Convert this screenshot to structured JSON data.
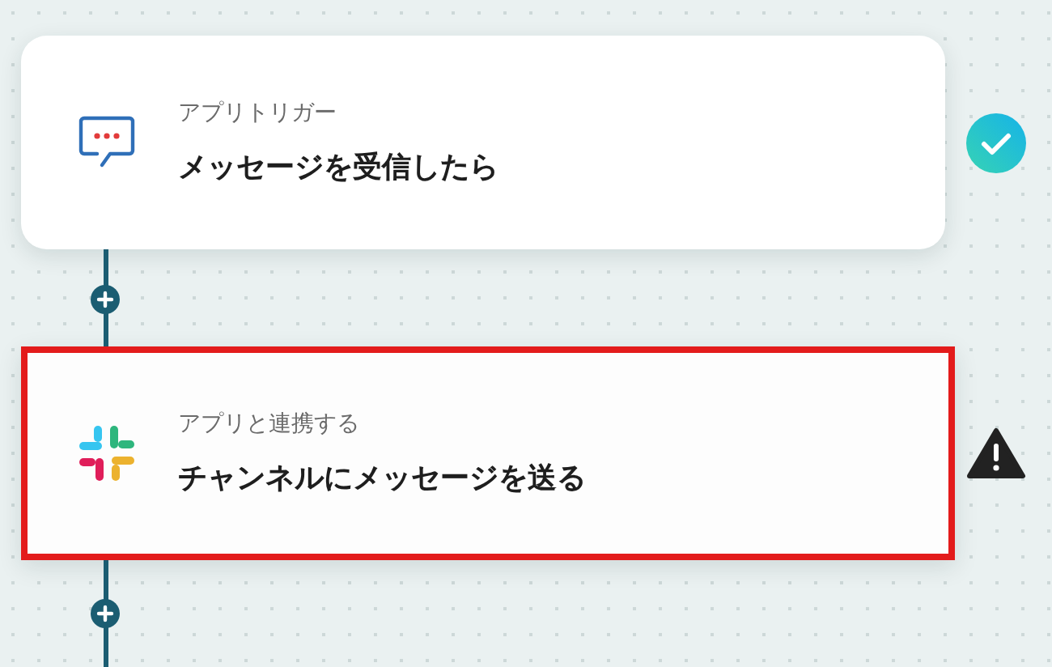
{
  "steps": [
    {
      "kind": "chat",
      "label": "アプリトリガー",
      "title": "メッセージを受信したら",
      "done": true,
      "warning": false,
      "highlighted": false
    },
    {
      "kind": "slack",
      "label": "アプリと連携する",
      "title": "チャンネルにメッセージを送る",
      "done": false,
      "warning": true,
      "highlighted": true
    }
  ]
}
